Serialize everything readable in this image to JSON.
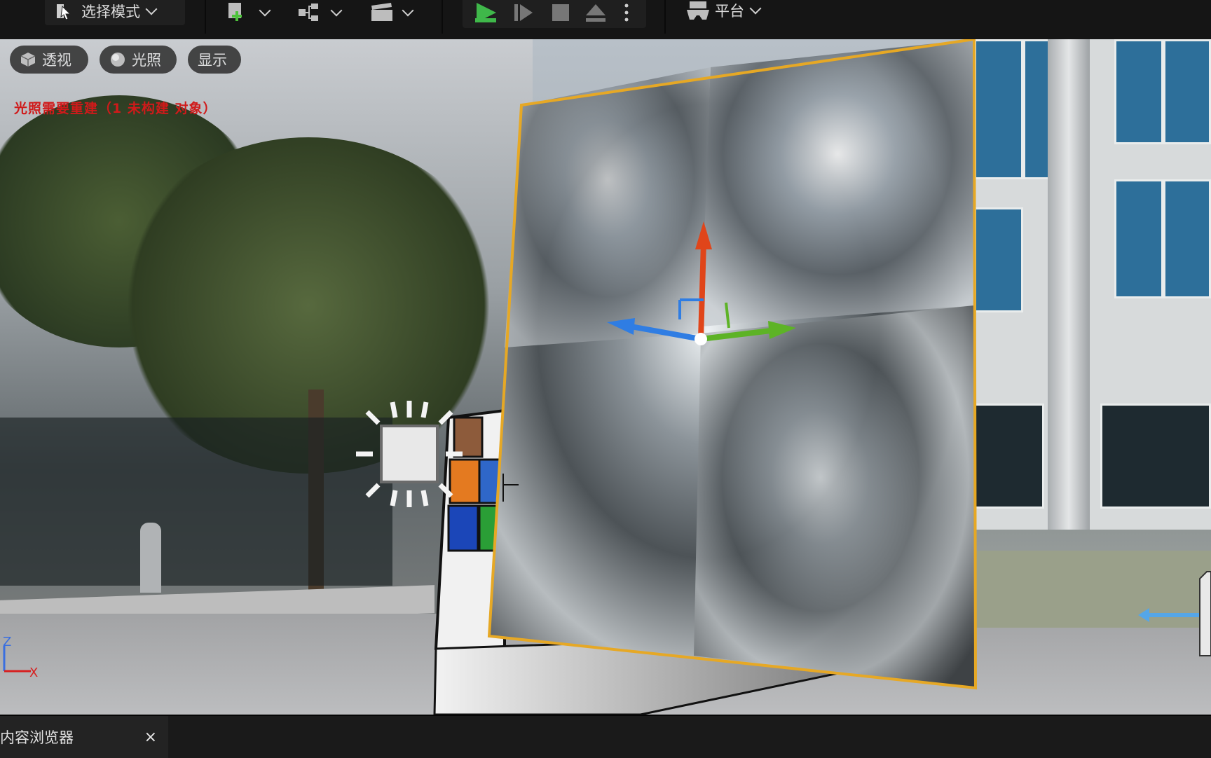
{
  "toolbar": {
    "mode_label": "选择模式",
    "platform_label": "平台",
    "icons": [
      "select-mode-icon",
      "add-actor-icon",
      "blueprint-icon",
      "cinematics-icon",
      "play-icon",
      "step-icon",
      "stop-icon",
      "eject-icon",
      "more-icon",
      "platform-icon"
    ]
  },
  "viewport": {
    "perspective_label": "透视",
    "lighting_label": "光照",
    "show_label": "显示",
    "warning_text": "光照需要重建（1 未构建 对象）",
    "axis_z": "Z",
    "axis_x": "X"
  },
  "bottom": {
    "tab_label": "内容浏览器",
    "close_label": "×"
  },
  "colors": {
    "warning": "#d01a1a",
    "gizmo_up": "#e0451a",
    "gizmo_forward": "#2f7de3",
    "gizmo_side": "#5db326",
    "selection_outline": "#e6a825"
  }
}
